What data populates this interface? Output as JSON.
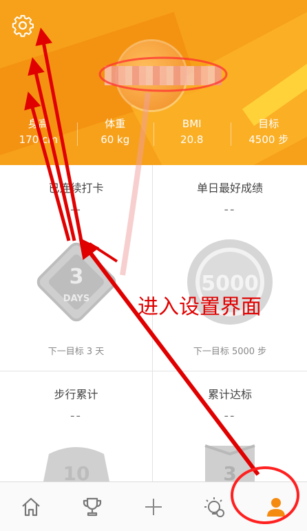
{
  "stats": [
    {
      "label": "身高",
      "value": "170 cm"
    },
    {
      "label": "体重",
      "value": "60 kg"
    },
    {
      "label": "BMI",
      "value": "20.8"
    },
    {
      "label": "目标",
      "value": "4500 步"
    }
  ],
  "cards": [
    {
      "title": "已连续打卡",
      "value": "--",
      "badge": "3",
      "badge_sub": "DAYS",
      "next": "下一目标 3 天"
    },
    {
      "title": "单日最好成绩",
      "value": "--",
      "badge": "5000",
      "badge_sub": "",
      "next": "下一目标 5000 步"
    },
    {
      "title": "步行累计",
      "value": "--",
      "badge": "10",
      "badge_sub": ""
    },
    {
      "title": "累计达标",
      "value": "--",
      "badge": "3",
      "badge_sub": ""
    }
  ],
  "annotation": {
    "text": "进入设置界面"
  },
  "tabs": [
    "home-icon",
    "trophy-icon",
    "plus-icon",
    "bulb-icon",
    "profile-icon"
  ],
  "colors": {
    "accent": "#f7a11a",
    "active_tab": "#f58a10",
    "annotation": "#e00000"
  }
}
